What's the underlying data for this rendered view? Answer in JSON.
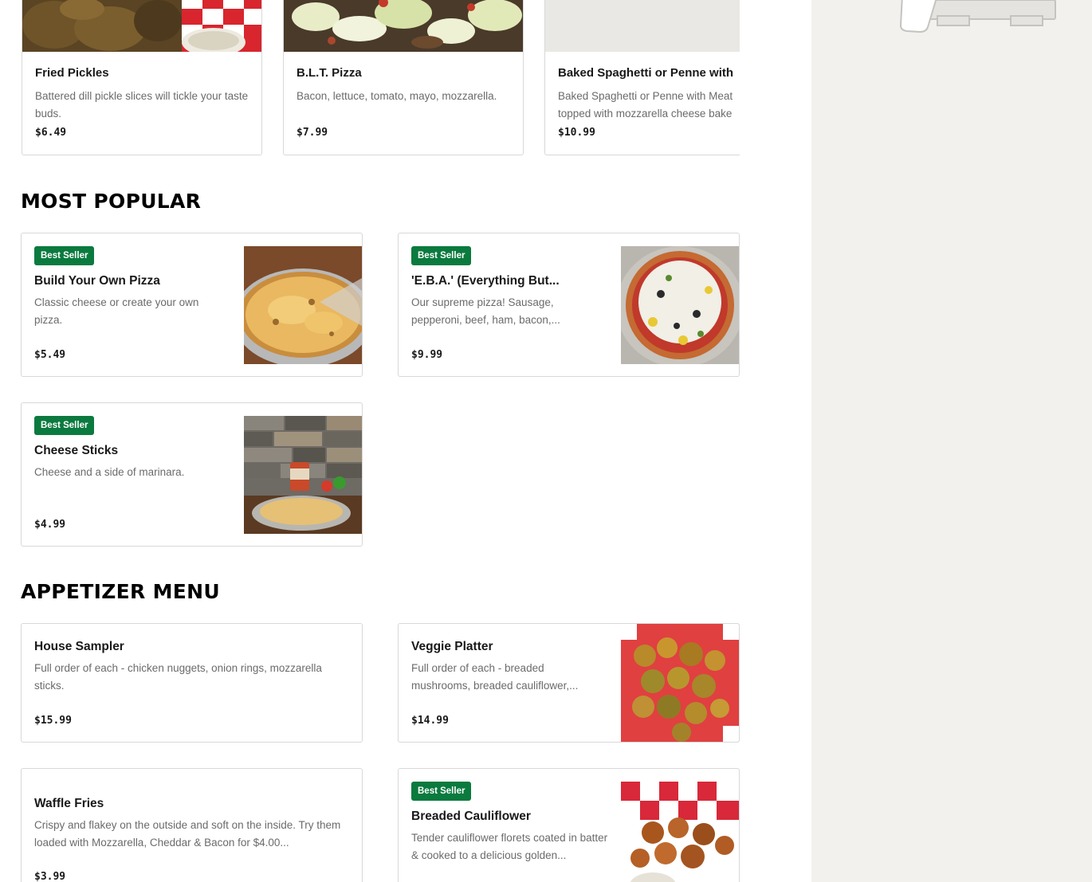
{
  "carousel": [
    {
      "name": "Fried Pickles",
      "description": "Battered dill pickle slices will tickle your taste buds.",
      "price": "$6.49"
    },
    {
      "name": "B.L.T. Pizza",
      "description": "Bacon, lettuce, tomato, mayo, mozzarella.",
      "price": "$7.99"
    },
    {
      "name": "Baked Spaghetti or Penne with",
      "description_line1": "Baked Spaghetti or Penne with Meat",
      "description_line2": "topped with mozzarella cheese bake",
      "price": "$10.99"
    }
  ],
  "most_popular": {
    "title": "MOST POPULAR",
    "items": [
      {
        "badge": "Best Seller",
        "name": "Build Your Own Pizza",
        "description": "Classic cheese or create your own pizza.",
        "price": "$5.49"
      },
      {
        "badge": "Best Seller",
        "name": "'E.B.A.' (Everything But...",
        "description": "Our supreme pizza! Sausage, pepperoni, beef, ham, bacon,...",
        "price": "$9.99"
      },
      {
        "badge": "Best Seller",
        "name": "Cheese Sticks",
        "description": "Cheese and a side of marinara.",
        "price": "$4.99"
      }
    ]
  },
  "appetizer_menu": {
    "title": "APPETIZER MENU",
    "items": [
      {
        "name": "House Sampler",
        "description": "Full order of each - chicken nuggets, onion rings, mozzarella sticks.",
        "price": "$15.99"
      },
      {
        "name": "Veggie Platter",
        "description": "Full order of each - breaded mushrooms, breaded cauliflower,...",
        "price": "$14.99"
      },
      {
        "name": "Waffle Fries",
        "description": "Crispy and flakey on the outside and soft on the inside. Try them loaded with Mozzarella, Cheddar & Bacon for $4.00...",
        "price": "$3.99"
      },
      {
        "badge": "Best Seller",
        "name": "Breaded Cauliflower",
        "description": "Tender cauliflower florets coated in batter & cooked to a delicious golden...",
        "price": ""
      }
    ]
  },
  "colors": {
    "badge_green": "#0b7a3e",
    "sidebar_bg": "#f2f1ee",
    "card_border": "#d8d8d8",
    "muted_text": "#6b6b6b"
  }
}
